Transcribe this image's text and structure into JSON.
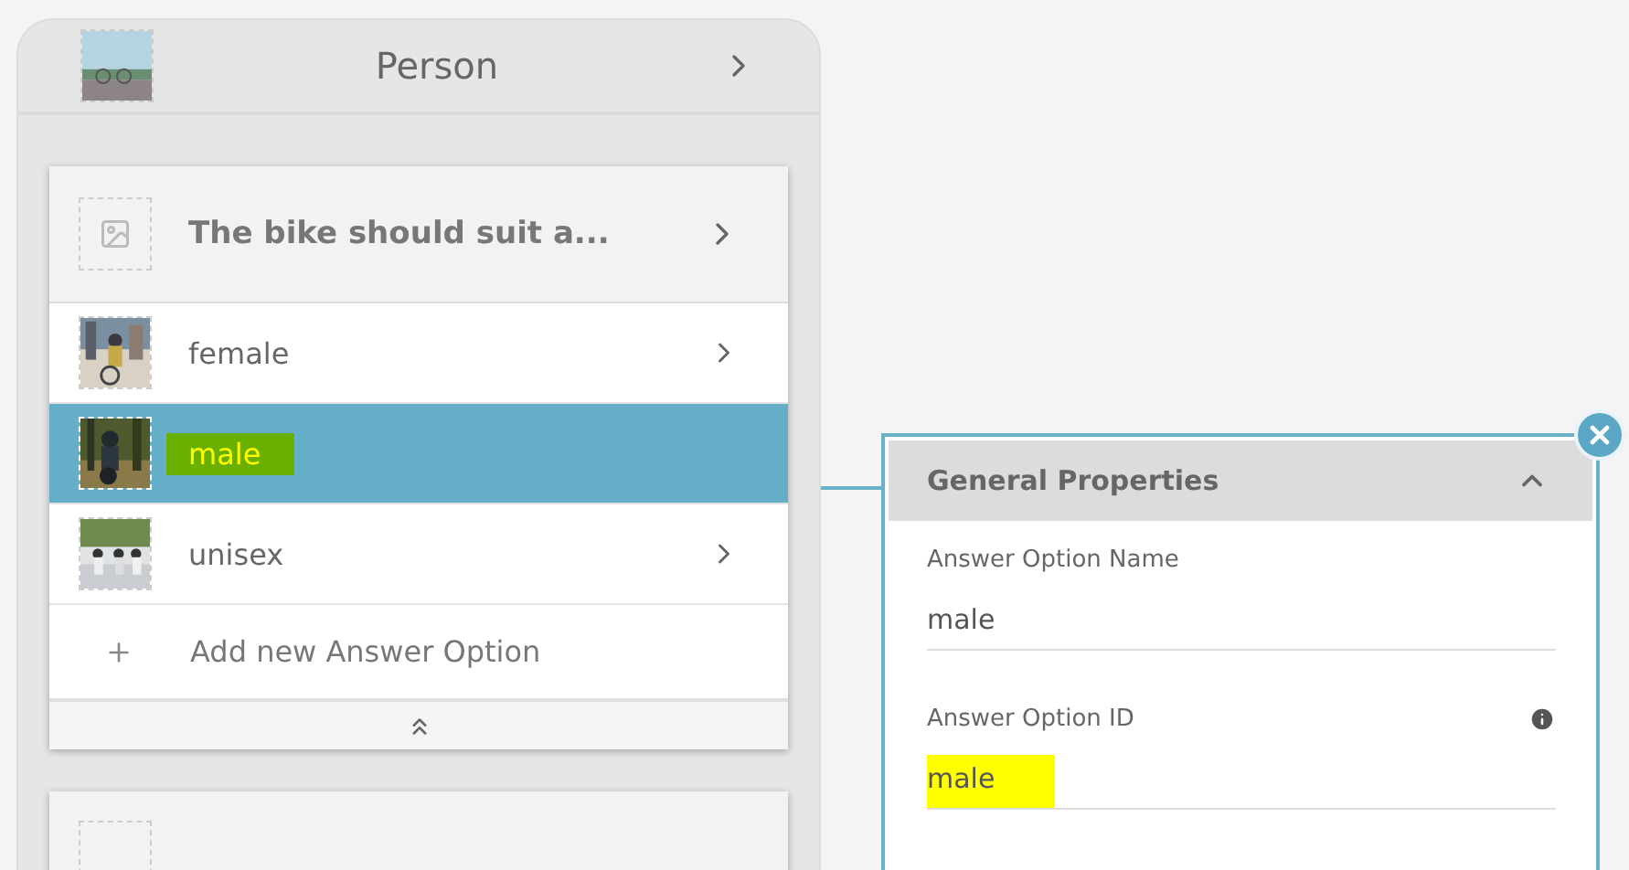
{
  "category": {
    "title": "Person"
  },
  "question": {
    "title": "The bike should suit a..."
  },
  "options": [
    {
      "label": "female",
      "selected": false,
      "highlighted": false
    },
    {
      "label": "male",
      "selected": true,
      "highlighted": true
    },
    {
      "label": "unisex",
      "selected": false,
      "highlighted": false
    }
  ],
  "add_option": {
    "label": "Add new Answer Option"
  },
  "properties": {
    "title": "General Properties",
    "expanded": true,
    "fields": [
      {
        "label": "Answer Option Name",
        "value": "male",
        "info": false,
        "highlighted": false
      },
      {
        "label": "Answer Option ID",
        "value": "male",
        "info": true,
        "highlighted": true
      }
    ]
  }
}
